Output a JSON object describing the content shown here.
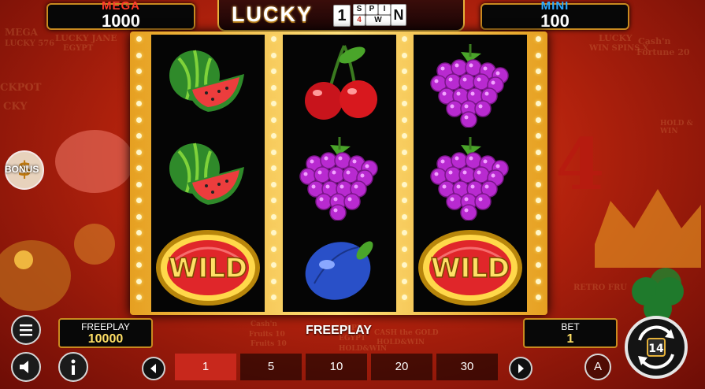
{
  "jackpots": {
    "mega": {
      "label": "MEGA",
      "value": "1000"
    },
    "mini": {
      "label": "MINI",
      "value": "100"
    }
  },
  "logo": {
    "word": "LUCKY",
    "tiles": [
      "1",
      "S",
      "P",
      "I",
      "N",
      "4",
      "W"
    ]
  },
  "reels": [
    [
      "watermelon",
      "watermelon",
      "wild"
    ],
    [
      "cherry",
      "grapes",
      "plum"
    ],
    [
      "grapes",
      "grapes",
      "wild"
    ]
  ],
  "wild_label": "WILD",
  "bonus_label": "BONUS",
  "background_texts": [
    "MEGA",
    "LUCKY JANE",
    "EGYPT",
    "LUCKY 576",
    "LUCKY",
    "WIN SPINS X",
    "Cash'n",
    "Fortune 20",
    "CKPOT",
    "CKY",
    "HOLD & WIN",
    "RETRO FRU",
    "CASH the GOLD",
    "Fruits 10",
    "EGYPT",
    "HOLD&WIN",
    "Cash'n",
    "Fruits 10",
    "EGYPT",
    "HOLD&WIN"
  ],
  "freeplay_box": {
    "label": "FREEPLAY",
    "value": "10000"
  },
  "freeplay_center": "FREEPLAY",
  "bet_box": {
    "label": "BET",
    "value": "1"
  },
  "lines": {
    "options": [
      "1",
      "5",
      "10",
      "20",
      "30"
    ],
    "selected": "1"
  },
  "auto_label": "A",
  "colors": {
    "accent_gold": "#e5b13a",
    "active_line": "#c8281c",
    "mega": "#ff3a2a",
    "mini": "#29a8ff"
  }
}
